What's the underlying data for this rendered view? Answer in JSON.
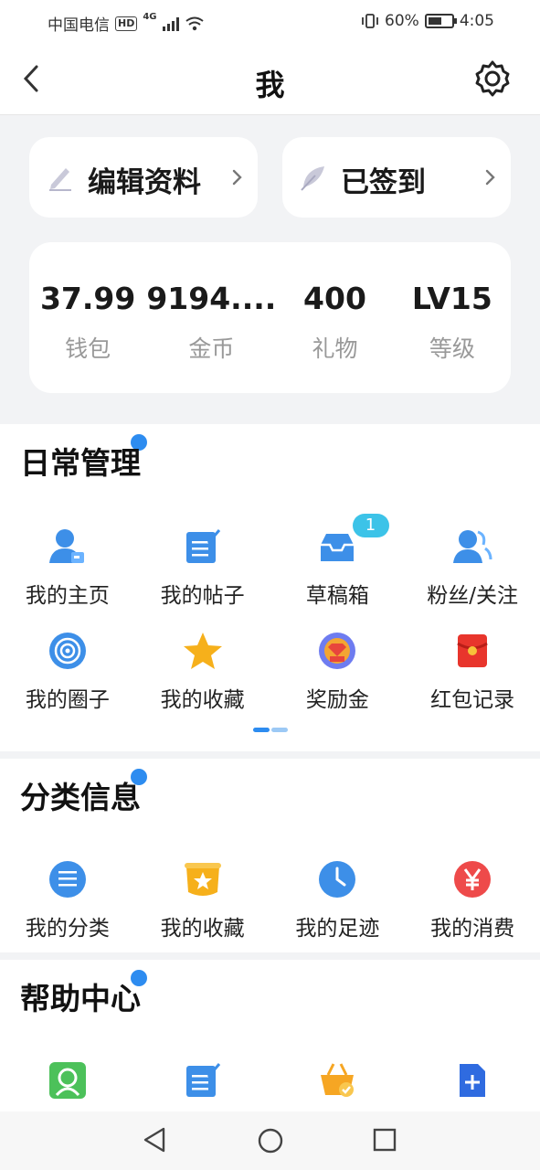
{
  "status_bar": {
    "carrier": "中国电信",
    "hd": "HD",
    "network": "4G",
    "battery_percent": "60%",
    "battery_level": 0.6,
    "time": "4:05"
  },
  "nav": {
    "title": "我",
    "back_icon": "chevron-left-icon",
    "settings_icon": "gear-icon"
  },
  "top_actions": [
    {
      "label": "编辑资料",
      "icon": "edit-pen-icon"
    },
    {
      "label": "已签到",
      "icon": "feather-icon"
    }
  ],
  "stats": [
    {
      "value": "37.99",
      "label": "钱包"
    },
    {
      "value": "9194....",
      "label": "金币"
    },
    {
      "value": "400",
      "label": "礼物"
    },
    {
      "value": "LV15",
      "label": "等级"
    }
  ],
  "daily": {
    "title": "日常管理",
    "items": [
      {
        "label": "我的主页",
        "icon": "user-card-icon"
      },
      {
        "label": "我的帖子",
        "icon": "post-edit-icon"
      },
      {
        "label": "草稿箱",
        "icon": "inbox-tray-icon",
        "badge": "1"
      },
      {
        "label": "粉丝/关注",
        "icon": "followers-icon"
      },
      {
        "label": "我的圈子",
        "icon": "circle-target-icon"
      },
      {
        "label": "我的收藏",
        "icon": "star-icon"
      },
      {
        "label": "奖励金",
        "icon": "reward-icon"
      },
      {
        "label": "红包记录",
        "icon": "red-envelope-icon"
      }
    ]
  },
  "category": {
    "title": "分类信息",
    "items": [
      {
        "label": "我的分类",
        "icon": "list-circle-icon"
      },
      {
        "label": "我的收藏",
        "icon": "favorite-box-icon"
      },
      {
        "label": "我的足迹",
        "icon": "clock-icon"
      },
      {
        "label": "我的消费",
        "icon": "yen-icon"
      }
    ]
  },
  "help": {
    "title": "帮助中心",
    "items": [
      {
        "label": "",
        "icon": "user-search-icon"
      },
      {
        "label": "",
        "icon": "post-edit-icon"
      },
      {
        "label": "",
        "icon": "basket-check-icon"
      },
      {
        "label": "",
        "icon": "file-add-icon"
      }
    ]
  },
  "system_nav": {
    "back_icon": "triangle-back-icon",
    "home_icon": "circle-home-icon",
    "recents_icon": "square-recents-icon"
  }
}
